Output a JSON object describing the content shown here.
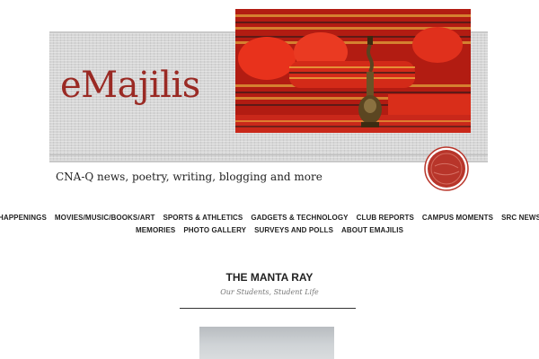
{
  "header": {
    "site_title": "eMajilis",
    "tagline": "CNA-Q news, poetry, writing, blogging and more"
  },
  "nav": {
    "row1": [
      "HAPPENINGS",
      "MOVIES/MUSIC/BOOKS/ART",
      "SPORTS & ATHLETICS",
      "GADGETS & TECHNOLOGY",
      "CLUB REPORTS",
      "CAMPUS MOMENTS",
      "SRC NEWS"
    ],
    "row2": [
      "MEMORIES",
      "PHOTO GALLERY",
      "SURVEYS AND POLLS",
      "ABOUT EMAJILIS"
    ]
  },
  "post": {
    "title": "THE MANTA RAY",
    "category_1": "Our Students",
    "separator": ", ",
    "category_2": "Student Life"
  },
  "colors": {
    "title_red": "#9a2a24",
    "seal_red": "#b8352a",
    "nav_text": "#1f1f1f"
  }
}
